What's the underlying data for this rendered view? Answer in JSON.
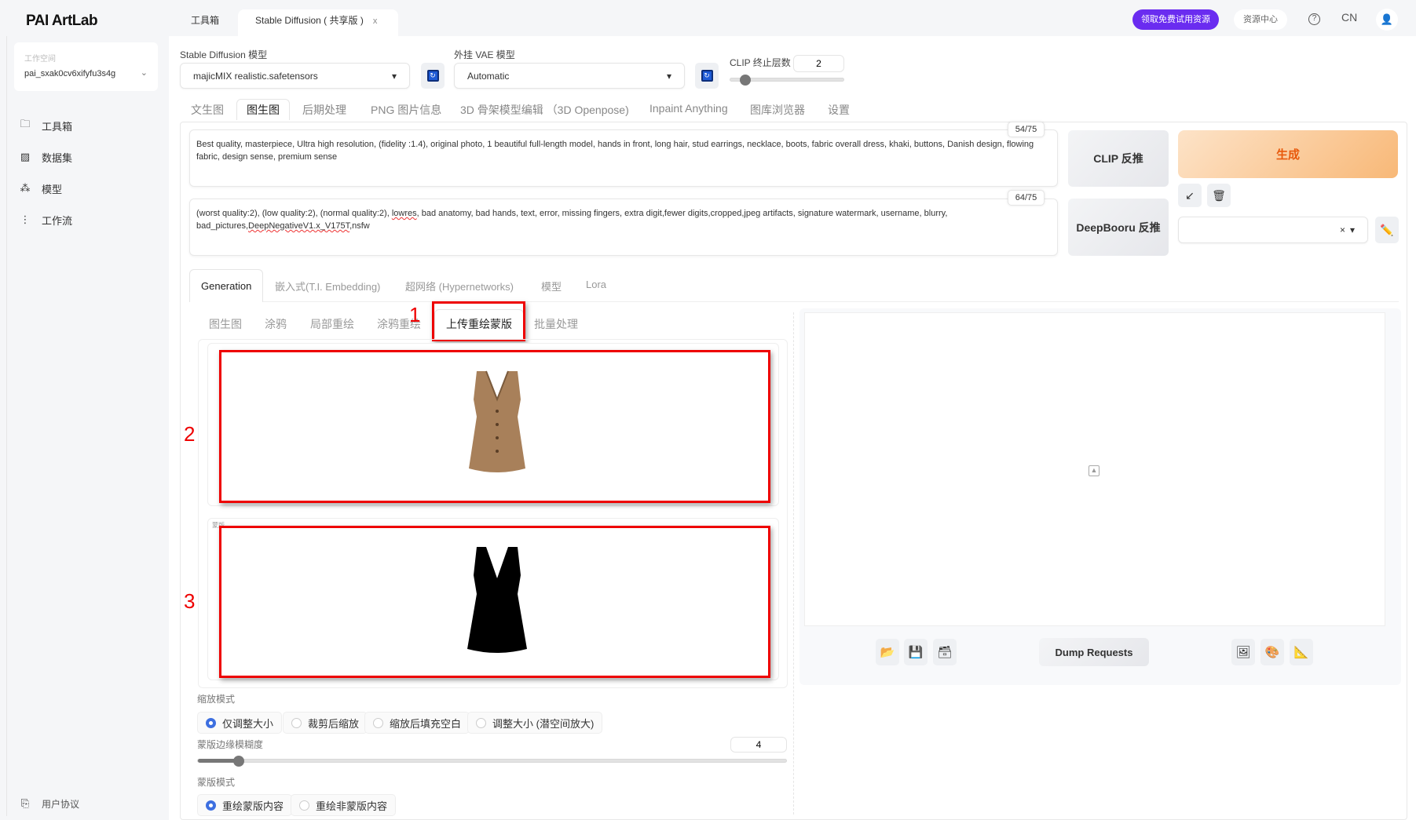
{
  "header": {
    "logo": "PAI ArtLab",
    "tabs": [
      {
        "label": "工具箱"
      },
      {
        "label": "Stable Diffusion ( 共享版 )",
        "close": "x"
      }
    ],
    "promo_button": "领取免费试用资源",
    "resource_center": "资源中心",
    "lang": "CN"
  },
  "sidebar": {
    "workspace_label": "工作空间",
    "workspace_value": "pai_sxak0cv6xifyfu3s4g",
    "items": [
      {
        "label": "工具箱"
      },
      {
        "label": "数据集"
      },
      {
        "label": "模型"
      },
      {
        "label": "工作流"
      }
    ],
    "footer": "用户协议"
  },
  "settings": {
    "sd_model_label": "Stable Diffusion 模型",
    "sd_model_value": "majicMIX realistic.safetensors",
    "vae_label": "外挂 VAE 模型",
    "vae_value": "Automatic",
    "clip_label": "CLIP 终止层数",
    "clip_value": "2",
    "clip_fraction": 0.08
  },
  "main_tabs": [
    "文生图",
    "图生图",
    "后期处理",
    "PNG 图片信息",
    "3D 骨架模型编辑 （3D Openpose)",
    "Inpaint Anything",
    "图库浏览器",
    "设置"
  ],
  "prompt": {
    "counter": "54/75",
    "text": "Best quality, masterpiece, Ultra high resolution, (fidelity :1.4), original photo, 1 beautiful full-length model, hands in front, long hair, stud earrings, necklace, boots, fabric overall dress, khaki, buttons, Danish design, flowing fabric, design sense, premium sense"
  },
  "negative": {
    "counter": "64/75",
    "text_a": "(worst quality:2), (low quality:2), (normal quality:2), ",
    "text_b": "lowres",
    "text_c": ", bad anatomy, bad hands, text, error, missing fingers, extra digit,fewer digits,cropped,jpeg artifacts, signature watermark, username, blurry, bad_pictures,",
    "text_d": "DeepNegativeV1.x_V175T",
    "text_e": ",nsfw"
  },
  "buttons": {
    "clip": "CLIP 反推",
    "deepbooru": "DeepBooru 反推",
    "generate": "生成",
    "dump": "Dump Requests",
    "clear": "×"
  },
  "gen_tabs": [
    "Generation",
    "嵌入式(T.I. Embedding)",
    "超网络 (Hypernetworks)",
    "模型",
    "Lora"
  ],
  "sub_tabs": [
    "图生图",
    "涂鸦",
    "局部重绘",
    "涂鸦重绘",
    "上传重绘蒙版",
    "批量处理"
  ],
  "annotations": [
    "1",
    "2",
    "3"
  ],
  "mask_label": "蒙版",
  "resize_mode": {
    "label": "缩放模式",
    "options": [
      "仅调整大小",
      "裁剪后缩放",
      "缩放后填充空白",
      "调整大小 (潜空间放大)"
    ],
    "selected": 0
  },
  "mask_blur": {
    "label": "蒙版边缘模糊度",
    "value": "4",
    "fraction": 0.06
  },
  "mask_mode": {
    "label": "蒙版模式",
    "options": [
      "重绘蒙版内容",
      "重绘非蒙版内容"
    ],
    "selected": 0
  },
  "colors": {
    "accent": "#6a2cf0",
    "generate": "#e8590c",
    "annotation": "#ee0000",
    "radio": "#3d6fe0"
  }
}
